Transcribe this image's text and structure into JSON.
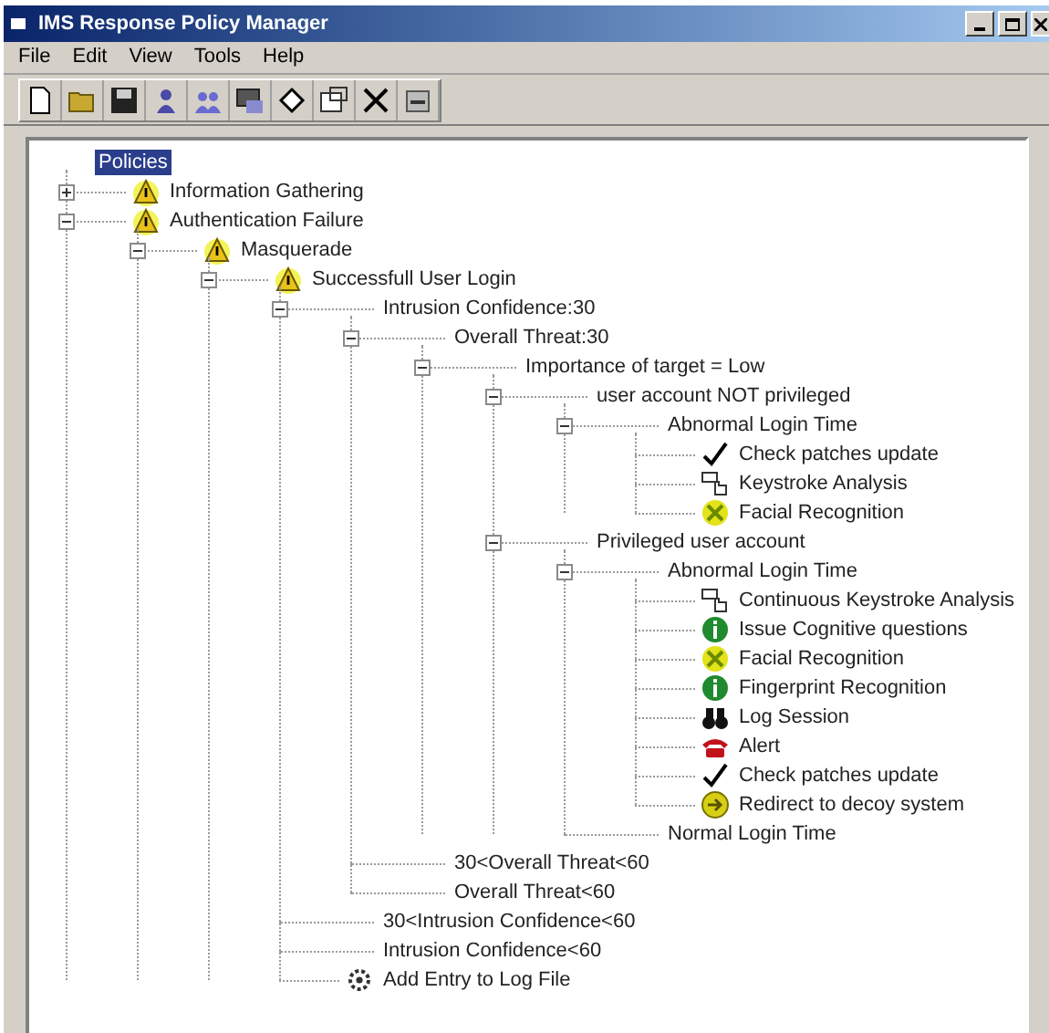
{
  "window": {
    "title": "IMS Response Policy Manager"
  },
  "menu": [
    "File",
    "Edit",
    "View",
    "Tools",
    "Help"
  ],
  "toolbar": [
    {
      "kind": "new"
    },
    {
      "kind": "open"
    },
    {
      "kind": "save"
    },
    {
      "kind": "user"
    },
    {
      "kind": "users"
    },
    {
      "kind": "group"
    },
    {
      "kind": "diamond"
    },
    {
      "kind": "properties"
    },
    {
      "kind": "delete"
    },
    {
      "kind": "exit"
    }
  ],
  "tree": {
    "label": "Policies",
    "selected": true,
    "children": [
      {
        "label": "Information Gathering",
        "kind": "alert",
        "selected": false,
        "expanded": false
      },
      {
        "label": "Authentication Failure",
        "kind": "alert",
        "selected": false,
        "expanded": true,
        "children": [
          {
            "label": "Masquerade",
            "kind": "alert",
            "selected": false,
            "expanded": true,
            "children": [
              {
                "label": "Successfull User Login",
                "kind": "alert",
                "selected": false,
                "expanded": true,
                "children": [
                  {
                    "label": "Intrusion Confidence:30",
                    "selected": false,
                    "expanded": true,
                    "children": [
                      {
                        "label": "Overall Threat:30",
                        "selected": false,
                        "expanded": true,
                        "children": [
                          {
                            "label": "Importance of target = Low",
                            "selected": false,
                            "expanded": true,
                            "children": [
                              {
                                "label": "user account NOT privileged",
                                "selected": false,
                                "expanded": true,
                                "children": [
                                  {
                                    "label": "Abnormal Login Time",
                                    "selected": false,
                                    "expanded": true,
                                    "children": [
                                      {
                                        "label": "Check patches update",
                                        "kind": "check",
                                        "selected": false
                                      },
                                      {
                                        "label": "Keystroke Analysis",
                                        "kind": "keystroke",
                                        "selected": false
                                      },
                                      {
                                        "label": "Facial Recognition",
                                        "kind": "face",
                                        "selected": false
                                      }
                                    ]
                                  }
                                ]
                              },
                              {
                                "label": "Privileged user account",
                                "selected": false,
                                "expanded": true,
                                "children": [
                                  {
                                    "label": "Abnormal Login Time",
                                    "selected": false,
                                    "expanded": true,
                                    "children": [
                                      {
                                        "label": "Continuous Keystroke Analysis",
                                        "kind": "keystroke",
                                        "selected": false
                                      },
                                      {
                                        "label": "Issue Cognitive questions",
                                        "kind": "info",
                                        "selected": false
                                      },
                                      {
                                        "label": "Facial Recognition",
                                        "kind": "face",
                                        "selected": false
                                      },
                                      {
                                        "label": "Fingerprint Recognition",
                                        "kind": "info",
                                        "selected": false
                                      },
                                      {
                                        "label": "Log Session",
                                        "kind": "binoculars",
                                        "selected": false
                                      },
                                      {
                                        "label": "Alert",
                                        "kind": "phone",
                                        "selected": false
                                      },
                                      {
                                        "label": "Check patches update",
                                        "kind": "check",
                                        "selected": false
                                      },
                                      {
                                        "label": "Redirect to decoy system",
                                        "kind": "redirect",
                                        "selected": false
                                      }
                                    ]
                                  },
                                  {
                                    "label": "Normal Login Time",
                                    "selected": false
                                  }
                                ]
                              }
                            ]
                          }
                        ]
                      },
                      {
                        "label": "30<Overall Threat<60",
                        "selected": false
                      },
                      {
                        "label": "Overall Threat<60",
                        "selected": false
                      }
                    ]
                  },
                  {
                    "label": "30<Intrusion Confidence<60",
                    "selected": false
                  },
                  {
                    "label": "Intrusion Confidence<60",
                    "selected": false
                  },
                  {
                    "label": "Add Entry to Log File",
                    "kind": "log",
                    "selected": false
                  }
                ]
              }
            ]
          }
        ]
      }
    ]
  }
}
